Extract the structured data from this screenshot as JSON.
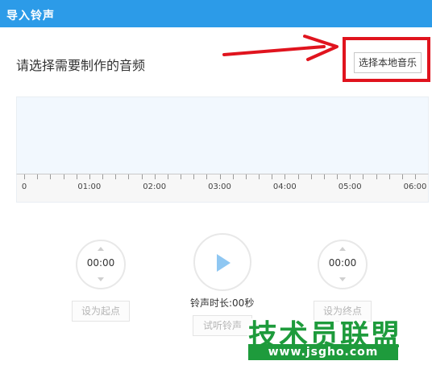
{
  "window": {
    "title": "导入铃声"
  },
  "prompt": "请选择需要制作的音频",
  "select_button": "选择本地音乐",
  "timeline": {
    "labels": [
      "0",
      "01:00",
      "02:00",
      "03:00",
      "04:00",
      "05:00",
      "06:00"
    ]
  },
  "start_control": {
    "time": "00:00",
    "button": "设为起点"
  },
  "end_control": {
    "time": "00:00",
    "button": "设为终点"
  },
  "player": {
    "duration_label": "铃声时长:00秒",
    "preview_button": "试听铃声"
  },
  "watermark": {
    "title": "技术员联盟",
    "url": "www.jsgho.com"
  },
  "colors": {
    "titlebar": "#2c9be8",
    "highlight": "#e0141e",
    "watermark": "#1e9b3c",
    "play": "#8fc7f2"
  }
}
